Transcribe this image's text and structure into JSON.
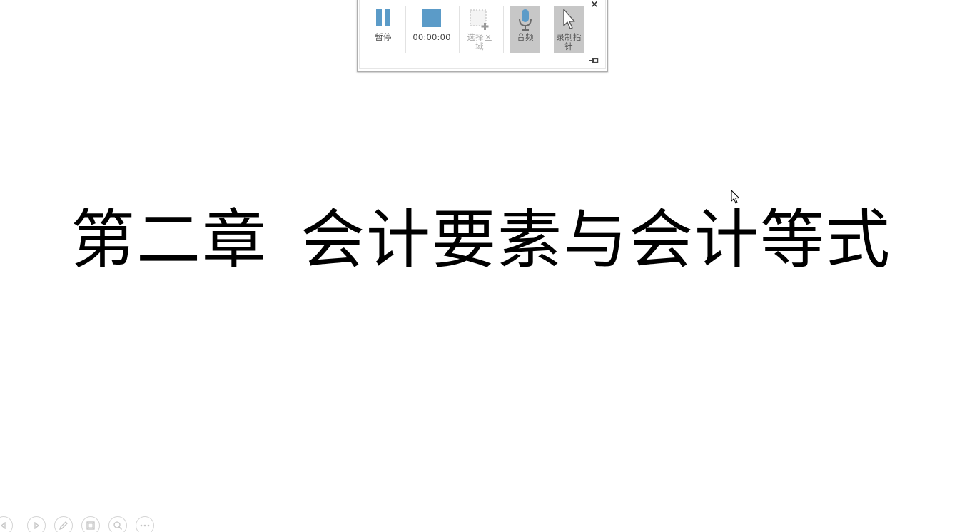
{
  "toolbar": {
    "pause_label": "暂停",
    "timer": "00:00:00",
    "select_area_label": "选择区\n域",
    "audio_label": "音频",
    "pointer_label": "录制指\n针",
    "close_glyph": "×",
    "accent_color": "#5b9bc8",
    "toggle_bg": "#c7c7c7"
  },
  "slide": {
    "title_part1": "第二章",
    "title_part2": "会计要素与会计等式"
  },
  "nav": {
    "buttons": [
      "previous-slide",
      "next-slide",
      "pen",
      "see-all-slides",
      "zoom",
      "more-options"
    ]
  }
}
